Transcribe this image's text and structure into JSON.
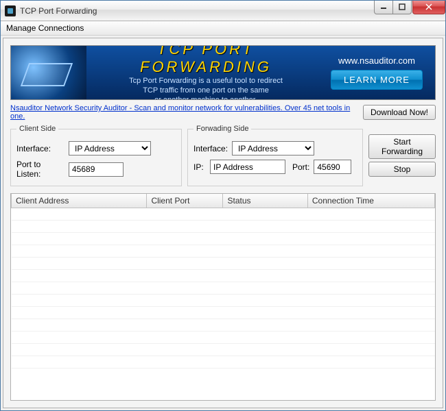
{
  "window": {
    "title": "TCP Port Forwarding"
  },
  "menu": {
    "manage_connections": "Manage Connections"
  },
  "banner": {
    "title": "TCP PORT FORWARDING",
    "desc_line1": "Tcp Port Forwarding is a useful tool to redirect",
    "desc_line2": "TCP  traffic from one port on the same",
    "desc_line3": "or another machine to another.",
    "url": "www.nsauditor.com",
    "learn_more": "LEARN MORE"
  },
  "promo": {
    "link": "Nsauditor Network Security Auditor - Scan and monitor network for vulnerabilities. Over 45 net tools in one.",
    "download": "Download Now!"
  },
  "client_side": {
    "legend": "Client Side",
    "interface_label": "Interface:",
    "interface_value": "IP Address",
    "port_label": "Port to Listen:",
    "port_value": "45689"
  },
  "forwarding_side": {
    "legend": "Forwading Side",
    "interface_label": "Interface:",
    "interface_value": "IP Address",
    "ip_label": "IP:",
    "ip_value": "IP Address",
    "port_label": "Port:",
    "port_value": "45690"
  },
  "actions": {
    "start": "Start Forwarding",
    "stop": "Stop"
  },
  "grid": {
    "columns": {
      "client_address": "Client Address",
      "client_port": "Client Port",
      "status": "Status",
      "connection_time": "Connection Time"
    }
  }
}
